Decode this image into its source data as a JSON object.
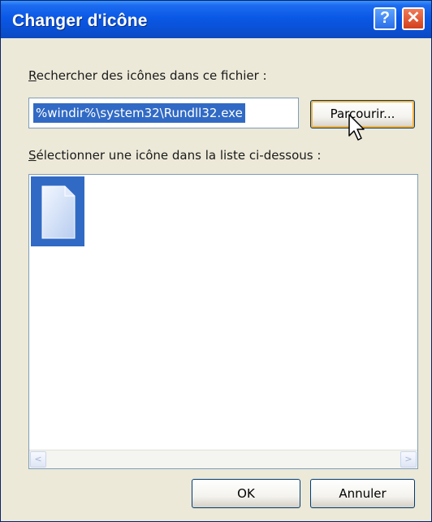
{
  "window": {
    "title": "Changer d'icône",
    "help_label": "?",
    "close_label": "✕"
  },
  "search": {
    "label_accel": "R",
    "label_rest": "echercher des icônes dans ce fichier :",
    "path_value": "%windir%\\system32\\Rundll32.exe",
    "browse_label": "Parcourir..."
  },
  "list": {
    "label_accel": "S",
    "label_rest": "électionner une icône dans la liste ci-dessous :",
    "icons": [
      {
        "name": "blank-document-icon",
        "selected": true
      }
    ]
  },
  "scrollbar": {
    "left_arrow": "<",
    "right_arrow": ">"
  },
  "footer": {
    "ok_label": "OK",
    "cancel_label": "Annuler"
  },
  "colors": {
    "title_bar": "#0a58e6",
    "selection": "#316ac5",
    "dialog_background": "#ece9d8"
  }
}
